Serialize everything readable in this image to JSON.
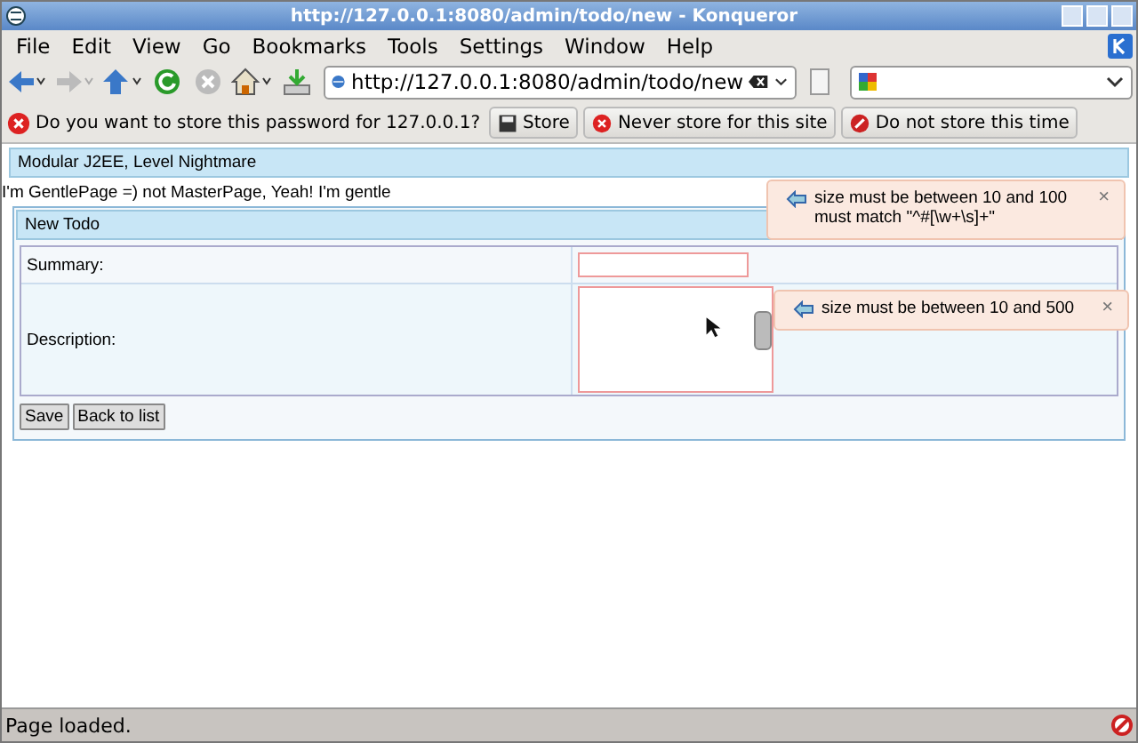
{
  "window": {
    "title": "http://127.0.0.1:8080/admin/todo/new - Konqueror"
  },
  "menu": [
    "File",
    "Edit",
    "View",
    "Go",
    "Bookmarks",
    "Tools",
    "Settings",
    "Window",
    "Help"
  ],
  "address": {
    "value": "http://127.0.0.1:8080/admin/todo/new"
  },
  "password_bar": {
    "message": "Do you want to store this password for 127.0.0.1?",
    "buttons": [
      {
        "kind": "store",
        "label": "Store"
      },
      {
        "kind": "never",
        "label": "Never store for this site"
      },
      {
        "kind": "not",
        "label": "Do not store this time"
      }
    ]
  },
  "page": {
    "header": "Modular J2EE, Level Nightmare",
    "intro": "I'm GentlePage =) not MasterPage, Yeah! I'm gentle",
    "panel": {
      "title": "New Todo",
      "fields": [
        {
          "kind": "input",
          "label": "Summary:"
        },
        {
          "kind": "textarea",
          "label": "Description:"
        }
      ],
      "buttons": [
        "Save",
        "Back to list"
      ]
    },
    "tooltips": [
      {
        "lines": [
          "size must be between 10 and 100",
          "must match \"^#[\\w+\\s]+\""
        ],
        "close": "×"
      },
      {
        "lines": [
          "size must be between 10 and 500"
        ],
        "close": "×"
      }
    ]
  },
  "status_bar": "Page loaded."
}
